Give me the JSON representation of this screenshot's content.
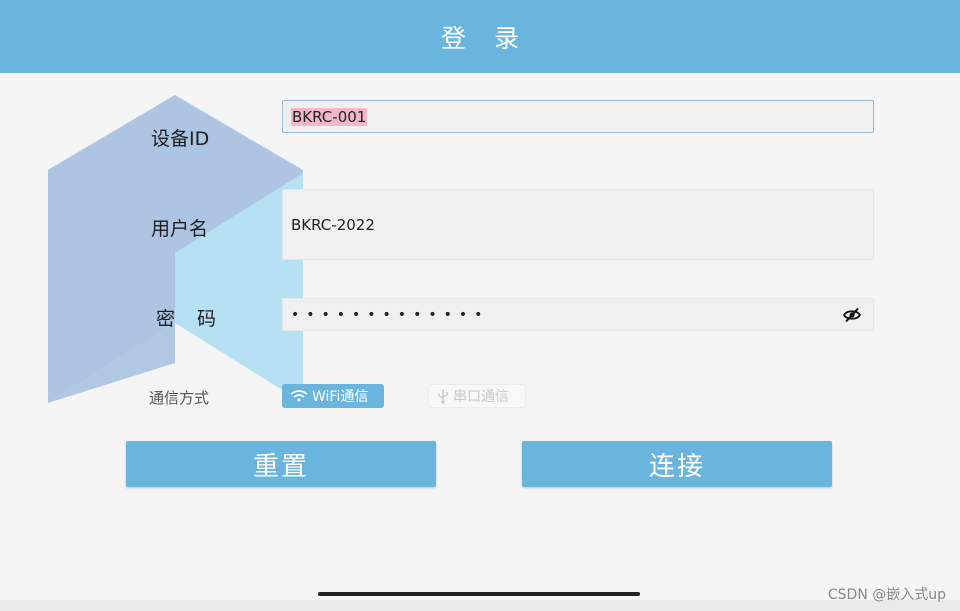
{
  "header": {
    "title": "登 录"
  },
  "form": {
    "device_label": "设备ID",
    "device_value": "BKRC-001",
    "user_label": "用户名",
    "user_value": "BKRC-2022",
    "password_label": "密 码",
    "password_value": "•••••••••••••",
    "comm_label": "通信方式",
    "wifi_label": "WiFi通信",
    "serial_label": "串口通信"
  },
  "buttons": {
    "reset": "重置",
    "connect": "连接"
  },
  "watermark": "CSDN @嵌入式up",
  "colors": {
    "accent": "#6ab5dd",
    "selection": "#f4b7c8",
    "logo_dark": "#adc5e2",
    "logo_light": "#b6e1f3"
  },
  "icons": {
    "eye": "eye-off-icon",
    "wifi": "wifi-icon",
    "usb": "usb-icon"
  }
}
